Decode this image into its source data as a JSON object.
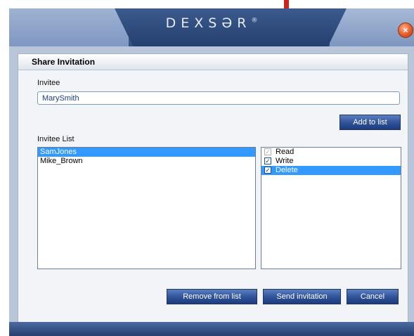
{
  "window": {
    "brand": "DEXSƏR",
    "brand_mark": "®",
    "close_icon": "×"
  },
  "dialog": {
    "title": "Share Invitation",
    "invitee_label": "Invitee",
    "invitee_value": "MarySmith",
    "add_button": "Add to list",
    "invitee_list_label": "Invitee List",
    "invitees": [
      {
        "name": "SamJones",
        "selected": true
      },
      {
        "name": "Mike_Brown",
        "selected": false
      }
    ],
    "permissions": [
      {
        "label": "Read",
        "checked": true,
        "disabled": true,
        "selected": false
      },
      {
        "label": "Write",
        "checked": true,
        "disabled": false,
        "selected": false
      },
      {
        "label": "Delete",
        "checked": true,
        "disabled": false,
        "selected": true
      }
    ],
    "remove_button": "Remove from list",
    "send_button": "Send invitation",
    "cancel_button": "Cancel"
  },
  "colors": {
    "selection": "#3399ff",
    "button": "#2e5197",
    "titlebar": "#344f82"
  },
  "icons": {
    "close": "close-icon",
    "checkbox": "checkbox-icon"
  }
}
